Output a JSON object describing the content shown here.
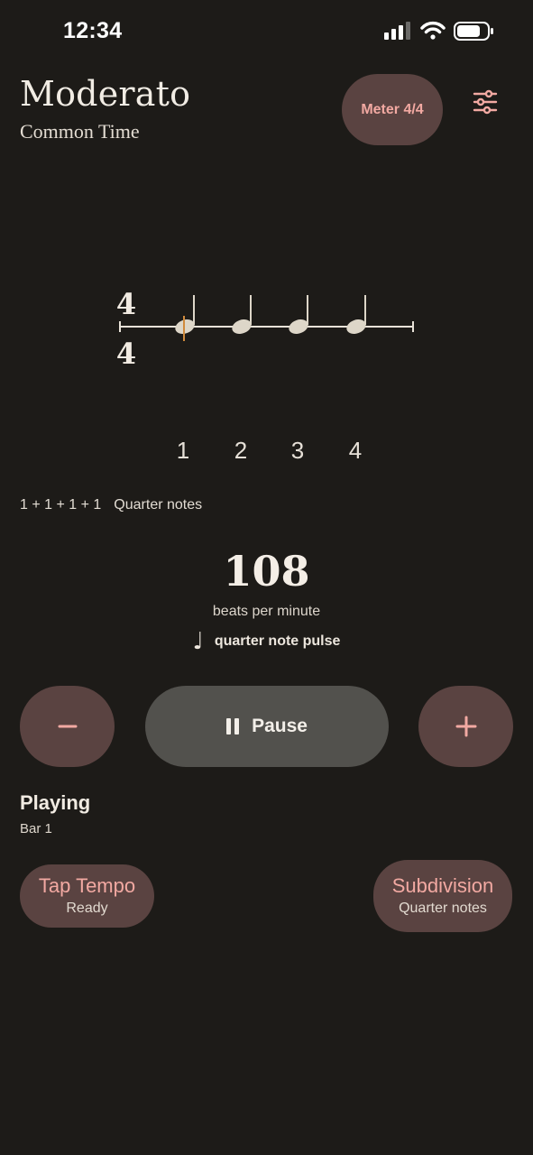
{
  "status": {
    "time": "12:34"
  },
  "header": {
    "title": "Moderato",
    "subtitle": "Common Time",
    "meter_label": "Meter 4/4"
  },
  "notation": {
    "time_signature_top": "4",
    "time_signature_bottom": "4",
    "beats": [
      "1",
      "2",
      "3",
      "4"
    ],
    "active_beat": "1"
  },
  "pattern": {
    "formula": "1 + 1 + 1 + 1",
    "name": "Quarter notes"
  },
  "tempo": {
    "bpm": "108",
    "unit_label": "beats per minute",
    "pulse_glyph": "♩",
    "pulse_label": "quarter note pulse"
  },
  "transport": {
    "minus_glyph": "−",
    "plus_glyph": "+",
    "pause_label": "Pause"
  },
  "playback": {
    "state": "Playing",
    "bar": "Bar 1"
  },
  "tap_tempo": {
    "title": "Tap Tempo",
    "status": "Ready"
  },
  "subdivision": {
    "title": "Subdivision",
    "value": "Quarter notes"
  },
  "colors": {
    "background": "#1d1b18",
    "accent": "#f2a9a2",
    "button_fill": "#5a4341",
    "pause_fill": "#52514d",
    "active_marker": "#d08a3c"
  }
}
